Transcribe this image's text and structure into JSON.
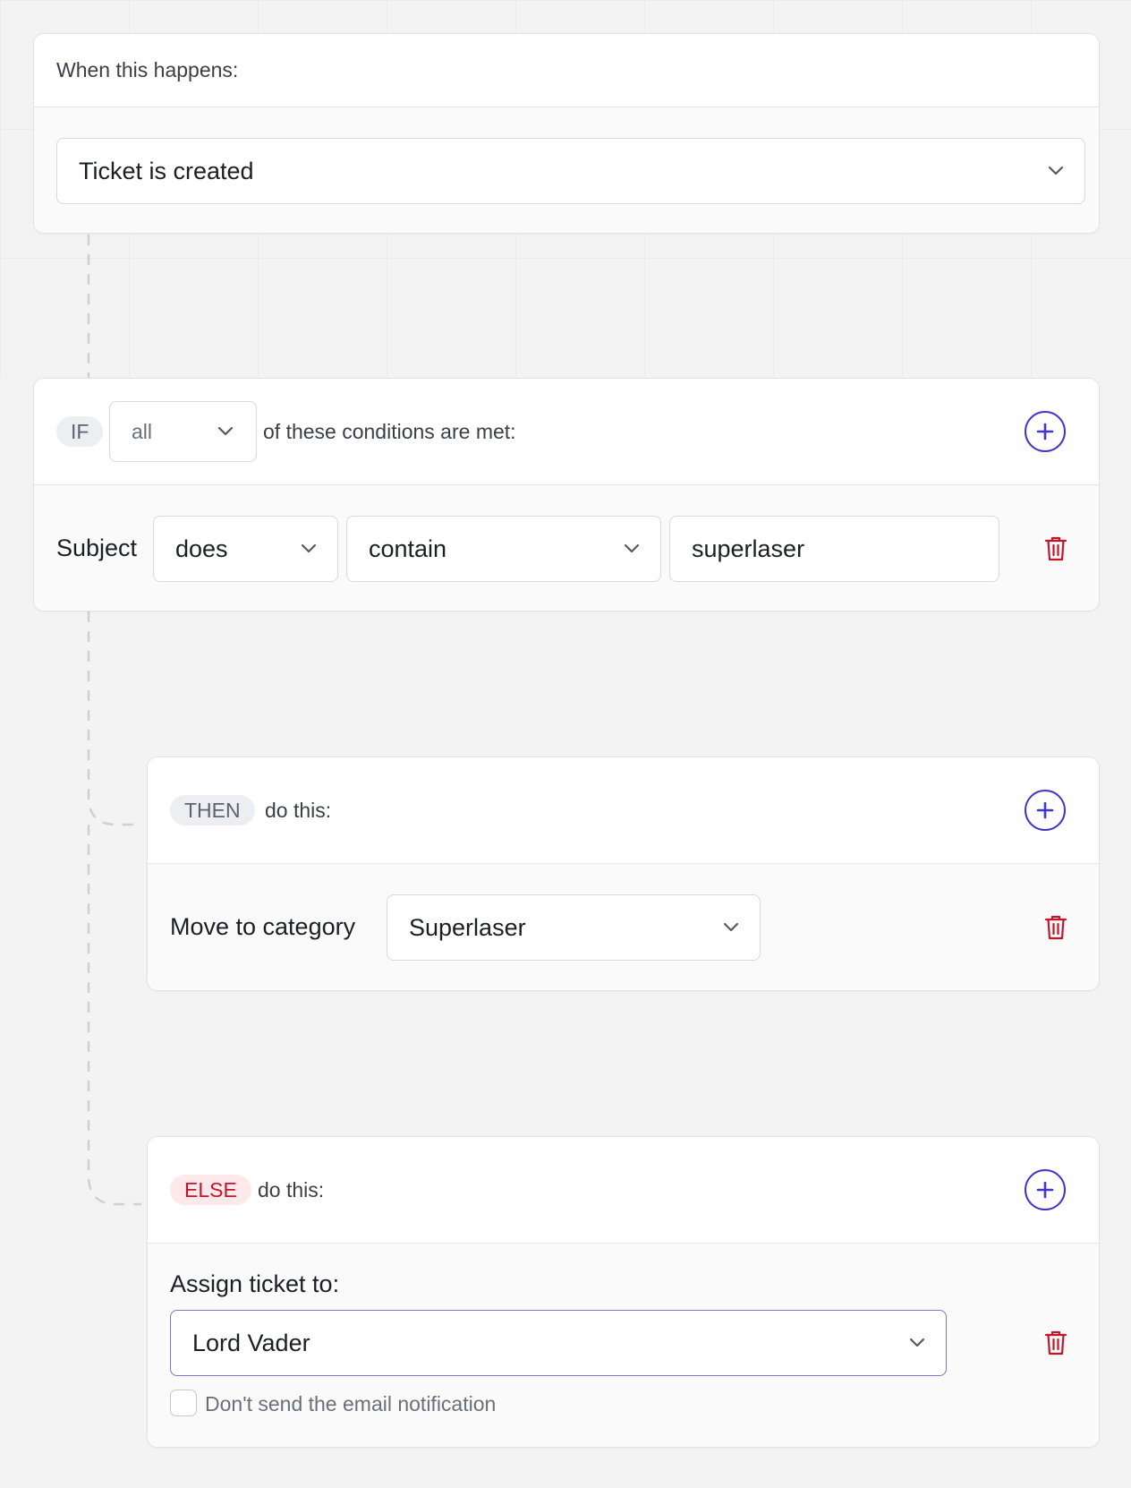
{
  "trigger": {
    "heading": "When this happens:",
    "event_value": "Ticket is created"
  },
  "condition_block": {
    "tag": "IF",
    "match_value": "all",
    "suffix": "of these conditions are met:",
    "rule": {
      "field": "Subject",
      "operator_value": "does",
      "comparison_value": "contain",
      "text_value": "superlaser"
    }
  },
  "then_block": {
    "tag": "THEN",
    "suffix": "do this:",
    "action": {
      "label": "Move to category",
      "category_value": "Superlaser"
    }
  },
  "else_block": {
    "tag": "ELSE",
    "suffix": "do this:",
    "action": {
      "label": "Assign ticket to:",
      "assignee_value": "Lord Vader",
      "checkbox_label": "Don't send the email notification",
      "checkbox_checked": false
    }
  },
  "icons": {
    "add": "plus-circle-icon",
    "delete": "trash-icon",
    "dropdown": "chevron-down-icon"
  },
  "colors": {
    "accent": "#3f37c9",
    "danger": "#c4162a",
    "tag_gray_bg": "#eceef1",
    "tag_red_bg": "#fde8ea"
  }
}
